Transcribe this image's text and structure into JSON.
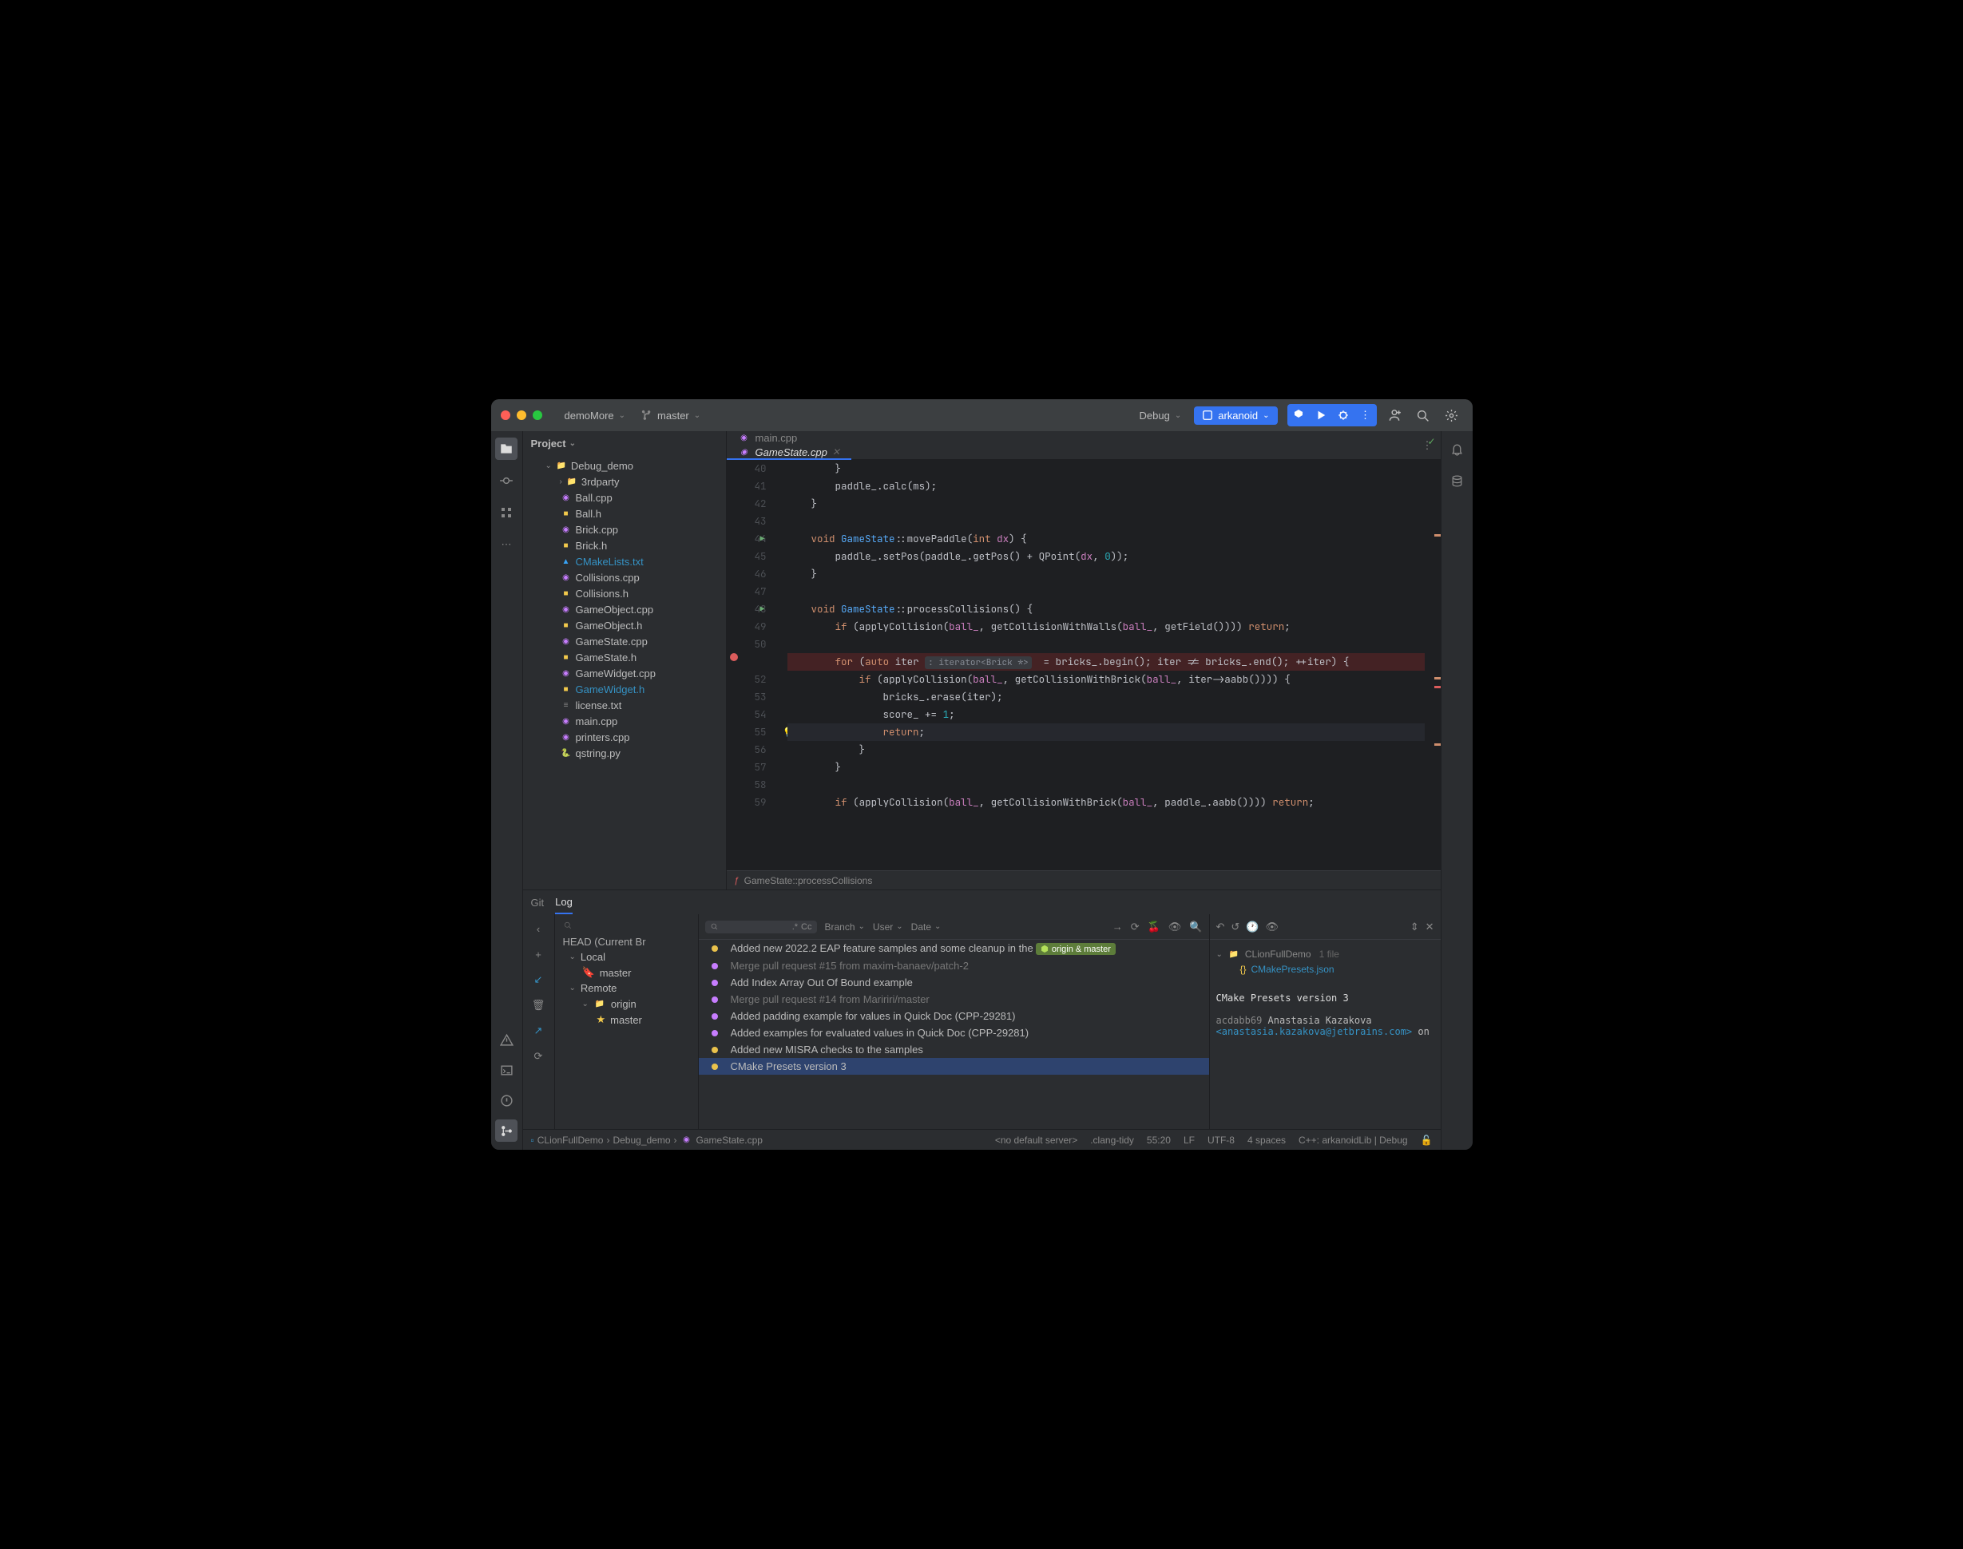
{
  "titlebar": {
    "project": "demoMore",
    "branch": "master",
    "runConfig": "Debug",
    "runTarget": "arkanoid"
  },
  "projectPane": {
    "header": "Project",
    "root": "Debug_demo",
    "items": [
      {
        "name": "3rdparty",
        "type": "folder",
        "indent": 2,
        "expandable": true
      },
      {
        "name": "Ball.cpp",
        "type": "cpp",
        "indent": 2
      },
      {
        "name": "Ball.h",
        "type": "h",
        "indent": 2
      },
      {
        "name": "Brick.cpp",
        "type": "cpp",
        "indent": 2
      },
      {
        "name": "Brick.h",
        "type": "h",
        "indent": 2
      },
      {
        "name": "CMakeLists.txt",
        "type": "cmake",
        "indent": 2,
        "blue": true
      },
      {
        "name": "Collisions.cpp",
        "type": "cpp",
        "indent": 2
      },
      {
        "name": "Collisions.h",
        "type": "h",
        "indent": 2
      },
      {
        "name": "GameObject.cpp",
        "type": "cpp",
        "indent": 2
      },
      {
        "name": "GameObject.h",
        "type": "h",
        "indent": 2
      },
      {
        "name": "GameState.cpp",
        "type": "cpp",
        "indent": 2
      },
      {
        "name": "GameState.h",
        "type": "h",
        "indent": 2
      },
      {
        "name": "GameWidget.cpp",
        "type": "cpp",
        "indent": 2
      },
      {
        "name": "GameWidget.h",
        "type": "h",
        "indent": 2,
        "blue": true
      },
      {
        "name": "license.txt",
        "type": "txt",
        "indent": 2
      },
      {
        "name": "main.cpp",
        "type": "cpp",
        "indent": 2
      },
      {
        "name": "printers.cpp",
        "type": "cpp",
        "indent": 2
      },
      {
        "name": "qstring.py",
        "type": "py",
        "indent": 2
      }
    ]
  },
  "editor": {
    "tabs": [
      {
        "name": "main.cpp",
        "active": false
      },
      {
        "name": "GameState.cpp",
        "active": true
      }
    ],
    "lines": [
      {
        "n": 40,
        "html": "        <span class='pun'>}</span>"
      },
      {
        "n": 41,
        "html": "        <span class='id'>paddle_</span><span class='pun'>.</span><span class='fn2'>calc</span><span class='pun'>(</span><span class='id'>ms</span><span class='pun'>);</span>"
      },
      {
        "n": 42,
        "html": "    <span class='pun'>}</span>"
      },
      {
        "n": 43,
        "html": ""
      },
      {
        "n": 44,
        "html": "    <span class='kw'>void</span> <span class='fn'>GameState</span><span class='pun'>::</span><span class='fn2'>movePaddle</span><span class='pun'>(</span><span class='kw'>int</span> <span class='param'>dx</span><span class='pun'>) {</span>",
        "run": true
      },
      {
        "n": 45,
        "html": "        <span class='id'>paddle_</span><span class='pun'>.</span><span class='fn2'>setPos</span><span class='pun'>(</span><span class='id'>paddle_</span><span class='pun'>.</span><span class='fn2'>getPos</span><span class='pun'>() + </span><span class='fn2'>QPoint</span><span class='pun'>(</span><span class='param'>dx</span><span class='pun'>, </span><span class='num'>0</span><span class='pun'>));</span>"
      },
      {
        "n": 46,
        "html": "    <span class='pun'>}</span>"
      },
      {
        "n": 47,
        "html": ""
      },
      {
        "n": 48,
        "html": "    <span class='kw'>void</span> <span class='fn'>GameState</span><span class='pun'>::</span><span class='fn2'>processCollisions</span><span class='pun'>() {</span>",
        "run": true
      },
      {
        "n": 49,
        "html": "        <span class='kw'>if</span> <span class='pun'>(</span><span class='fn2'>applyCollision</span><span class='pun'>(</span><span class='param'>ball_</span><span class='pun'>, </span><span class='fn2'>getCollisionWithWalls</span><span class='pun'>(</span><span class='param'>ball_</span><span class='pun'>, </span><span class='fn2'>getField</span><span class='pun'>())))</span> <span class='kw'>return</span><span class='pun'>;</span>"
      },
      {
        "n": 50,
        "html": ""
      },
      {
        "n": "",
        "html": "        <span class='kw'>for</span> <span class='pun'>(</span><span class='kw'>auto</span> <span class='id'>iter</span> <span class='hint'>: iterator&lt;Brick *&gt;</span>  <span class='pun'>=</span> <span class='id'>bricks_</span><span class='pun'>.</span><span class='fn2'>begin</span><span class='pun'>();</span> <span class='id'>iter</span> <span class='pun'>!=</span> <span class='id'>bricks_</span><span class='pun'>.</span><span class='fn2'>end</span><span class='pun'>();</span> <span class='pun'>++</span><span class='id'>iter</span><span class='pun'>) {</span>",
        "bp": true
      },
      {
        "n": 52,
        "html": "            <span class='kw'>if</span> <span class='pun'>(</span><span class='fn2'>applyCollision</span><span class='pun'>(</span><span class='param'>ball_</span><span class='pun'>, </span><span class='fn2'>getCollisionWithBrick</span><span class='pun'>(</span><span class='param'>ball_</span><span class='pun'>, </span><span class='id'>iter</span><span class='pun'>-&gt;</span><span class='fn2'>aabb</span><span class='pun'>()))) {</span>"
      },
      {
        "n": 53,
        "html": "                <span class='id'>bricks_</span><span class='pun'>.</span><span class='fn2'>erase</span><span class='pun'>(</span><span class='id'>iter</span><span class='pun'>);</span>"
      },
      {
        "n": 54,
        "html": "                <span class='id'>score_</span> <span class='pun'>+=</span> <span class='num'>1</span><span class='pun'>;</span>"
      },
      {
        "n": 55,
        "html": "                <span class='kw'>return</span><span class='pun'>;</span>",
        "bulb": true,
        "hl": true
      },
      {
        "n": 56,
        "html": "            <span class='pun'>}</span>"
      },
      {
        "n": 57,
        "html": "        <span class='pun'>}</span>"
      },
      {
        "n": 58,
        "html": ""
      },
      {
        "n": 59,
        "html": "        <span class='kw'>if</span> <span class='pun'>(</span><span class='fn2'>applyCollision</span><span class='pun'>(</span><span class='param'>ball_</span><span class='pun'>, </span><span class='fn2'>getCollisionWithBrick</span><span class='pun'>(</span><span class='param'>ball_</span><span class='pun'>, </span><span class='id'>paddle_</span><span class='pun'>.</span><span class='fn2'>aabb</span><span class='pun'>())))</span> <span class='kw'>return</span><span class='pun'>;</span>"
      }
    ],
    "breadcrumb": "GameState::processCollisions"
  },
  "git": {
    "tabs": [
      "Git",
      "Log"
    ],
    "filterLabels": {
      "branch": "Branch",
      "user": "User",
      "date": "Date",
      "regex": ".*",
      "matchCase": "Cc"
    },
    "branches": {
      "head": "HEAD (Current Br",
      "local": "Local",
      "localItems": [
        {
          "name": "master",
          "star": true
        }
      ],
      "remote": "Remote",
      "remoteItems": [
        {
          "name": "origin",
          "folder": true
        },
        {
          "name": "master",
          "star": true,
          "indent": true
        }
      ]
    },
    "commits": [
      {
        "msg": "Added new 2022.2 EAP feature samples and some cleanup in the",
        "tag": "origin & master",
        "color": "#eac24c"
      },
      {
        "msg": "Merge pull request #15 from maxim-banaev/patch-2",
        "merge": true,
        "color": "#c77dff"
      },
      {
        "msg": "Add Index Array Out Of Bound example",
        "color": "#c77dff"
      },
      {
        "msg": "Merge pull request #14 from Maririri/master",
        "merge": true,
        "color": "#c77dff"
      },
      {
        "msg": "Added padding example for values in Quick Doc (CPP-29281)",
        "color": "#c77dff"
      },
      {
        "msg": "Added examples for evaluated values in Quick Doc (CPP-29281)",
        "color": "#c77dff"
      },
      {
        "msg": "Added new MISRA checks to the samples",
        "color": "#eac24c"
      },
      {
        "msg": "CMake Presets version 3",
        "sel": true,
        "color": "#eac24c"
      }
    ],
    "details": {
      "folder": "CLionFullDemo",
      "fileCount": "1 file",
      "file": "CMakePresets.json",
      "title": "CMake Presets version 3",
      "hash": "acdabb69",
      "author": "Anastasia Kazakova",
      "email": "<anastasia.kazakova@jetbrains.com>",
      "on": "on"
    }
  },
  "statusbar": {
    "crumbs": [
      "CLionFullDemo",
      "Debug_demo",
      "GameState.cpp"
    ],
    "server": "<no default server>",
    "tidy": ".clang-tidy",
    "pos": "55:20",
    "lf": "LF",
    "enc": "UTF-8",
    "indent": "4 spaces",
    "config": "C++: arkanoidLib | Debug"
  }
}
